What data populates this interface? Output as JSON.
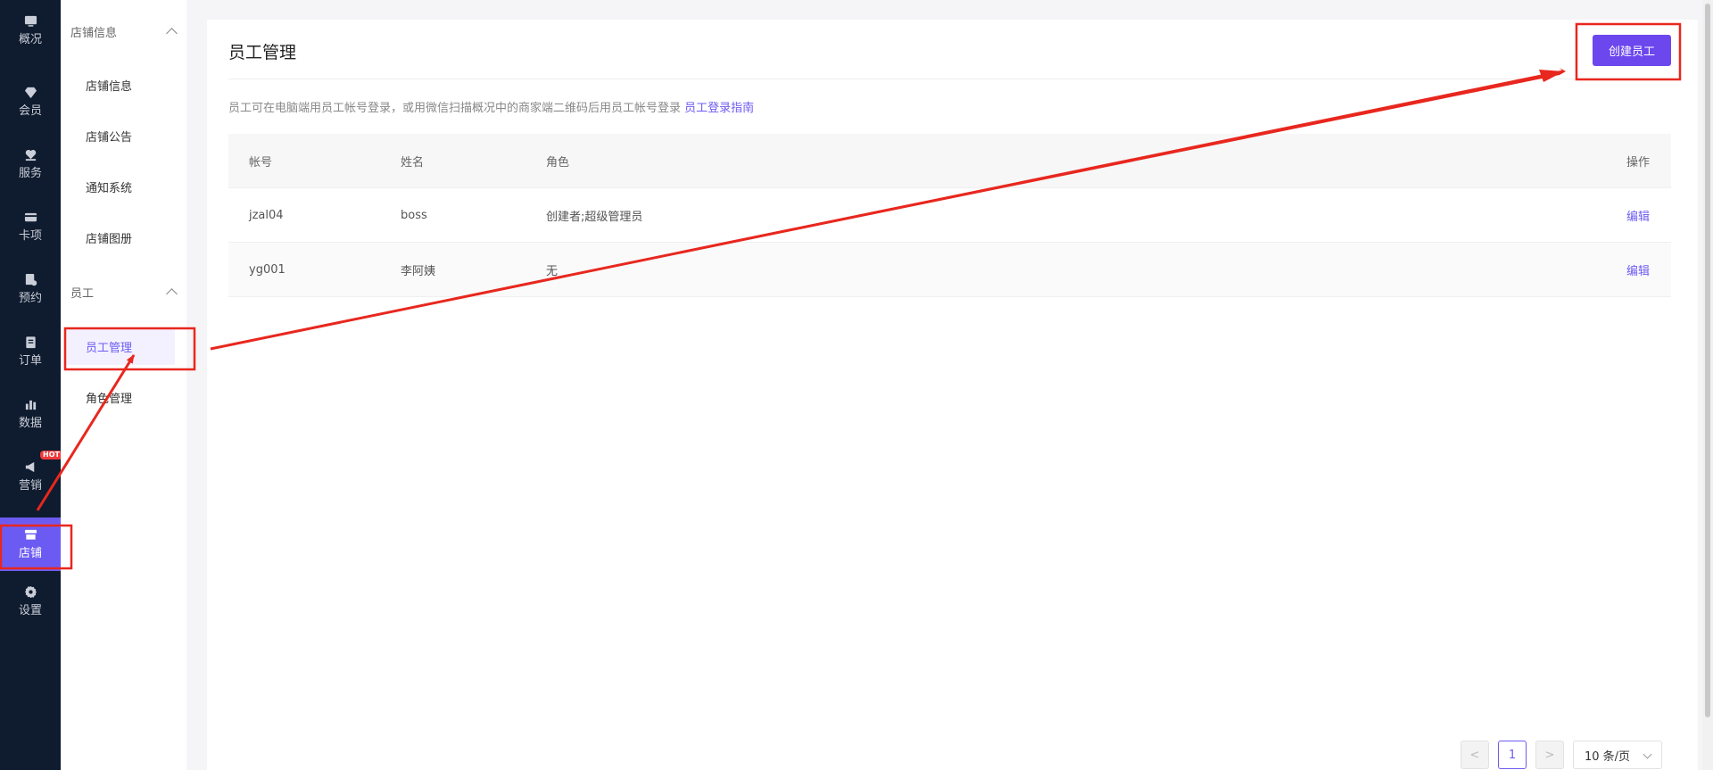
{
  "rail": {
    "items": [
      {
        "label": "概况",
        "icon": "monitor-icon"
      },
      {
        "label": "会员",
        "icon": "diamond-icon"
      },
      {
        "label": "服务",
        "icon": "heart-hand-icon"
      },
      {
        "label": "卡项",
        "icon": "card-icon"
      },
      {
        "label": "预约",
        "icon": "calendar-icon"
      },
      {
        "label": "订单",
        "icon": "clipboard-icon"
      },
      {
        "label": "数据",
        "icon": "bar-chart-icon"
      },
      {
        "label": "营销",
        "icon": "megaphone-icon",
        "badge": "HOT"
      },
      {
        "label": "店铺",
        "icon": "store-icon",
        "active": true
      },
      {
        "label": "设置",
        "icon": "gear-icon"
      }
    ]
  },
  "submenu": {
    "group1": {
      "title": "店铺信息",
      "items": [
        "店铺信息",
        "店铺公告",
        "通知系统",
        "店铺图册"
      ]
    },
    "group2": {
      "title": "员工",
      "items": [
        "员工管理",
        "角色管理"
      ]
    }
  },
  "main": {
    "title": "员工管理",
    "create_button": "创建员工",
    "hint_text": "员工可在电脑端用员工帐号登录，或用微信扫描概况中的商家端二维码后用员工帐号登录",
    "hint_link": "员工登录指南",
    "table": {
      "headers": {
        "account": "帐号",
        "name": "姓名",
        "role": "角色",
        "actions": "操作"
      },
      "rows": [
        {
          "account": "jzal04",
          "name": "boss",
          "role": "创建者;超级管理员",
          "action": "编辑"
        },
        {
          "account": "yg001",
          "name": "李阿姨",
          "role": "无",
          "action": "编辑"
        }
      ]
    },
    "pagination": {
      "prev": "<",
      "current_page": "1",
      "next": ">",
      "page_size": "10 条/页"
    }
  },
  "colors": {
    "accent": "#6c5bf2",
    "button": "#6c47ee",
    "rail_bg": "#0f1b2e",
    "annotation": "#e8271e"
  }
}
